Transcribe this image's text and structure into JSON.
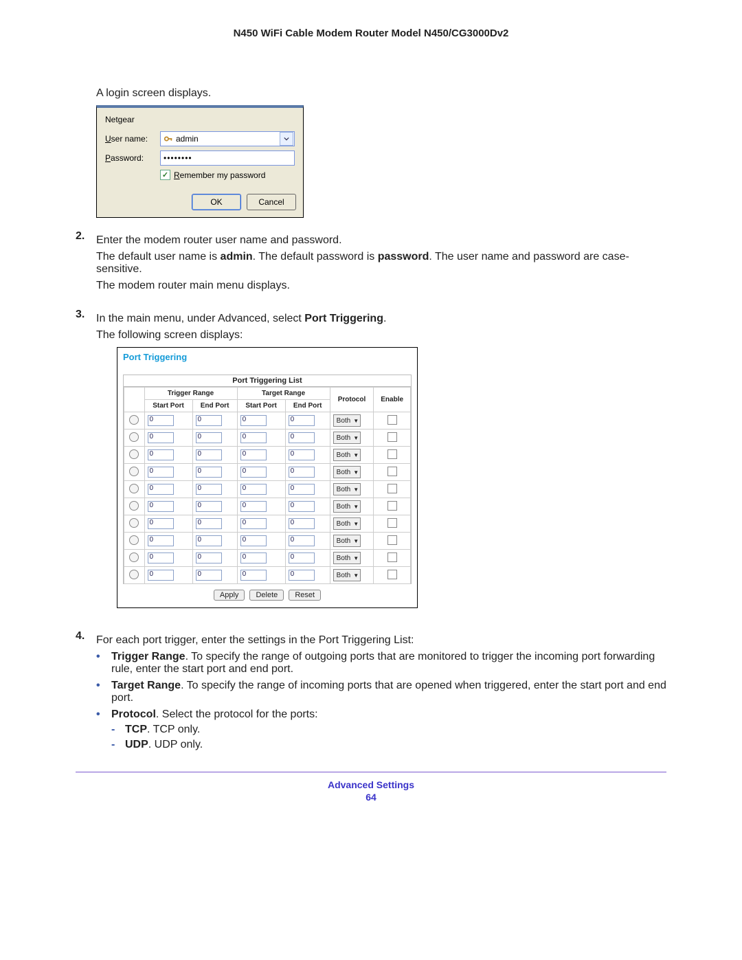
{
  "header": {
    "title": "N450 WiFi Cable Modem Router Model N450/CG3000Dv2"
  },
  "body": {
    "intro_line": "A login screen displays.",
    "login_dialog": {
      "brand": "Netgear",
      "username_label_u": "U",
      "username_label_rest": "ser name:",
      "username_value": "admin",
      "password_label_u": "P",
      "password_label_rest": "assword:",
      "password_value": "••••••••",
      "remember_cb_checked": "✓",
      "remember_label_u": "R",
      "remember_label_rest": "emember my password",
      "ok": "OK",
      "cancel": "Cancel"
    },
    "step2": {
      "num": "2.",
      "line1": "Enter the modem router user name and password.",
      "line2_pre": "The default user name is ",
      "line2_b1": "admin",
      "line2_mid": ". The default password is ",
      "line2_b2": "password",
      "line2_post": ". The user name and password are case-sensitive.",
      "line3": "The modem router main menu displays."
    },
    "step3": {
      "num": "3.",
      "line1_pre": "In the main menu, under Advanced, select ",
      "line1_b": "Port Triggering",
      "line1_post": ".",
      "line2": "The following screen displays:"
    },
    "pt": {
      "title": "Port Triggering",
      "table_caption": "Port Triggering List",
      "group_trigger": "Trigger Range",
      "group_target": "Target Range",
      "col_startport": "Start Port",
      "col_endport": "End Port",
      "col_protocol": "Protocol",
      "col_enable": "Enable",
      "cell_default": "0",
      "protocol_default": "Both",
      "row_count": 10,
      "btn_apply": "Apply",
      "btn_delete": "Delete",
      "btn_reset": "Reset"
    },
    "step4": {
      "num": "4.",
      "line1": "For each port trigger, enter the settings in the Port Triggering List:",
      "b1_b": "Trigger Range",
      "b1_rest": ". To specify the range of outgoing ports that are monitored to trigger the incoming port forwarding rule, enter the start port and end port.",
      "b2_b": "Target Range",
      "b2_rest": ". To specify the range of incoming ports that are opened when triggered, enter the start port and end port.",
      "b3_b": "Protocol",
      "b3_rest": ". Select the protocol for the ports:",
      "d1_b": "TCP",
      "d1_rest": ". TCP only.",
      "d2_b": "UDP",
      "d2_rest": ". UDP only."
    }
  },
  "footer": {
    "title": "Advanced Settings",
    "page": "64"
  }
}
